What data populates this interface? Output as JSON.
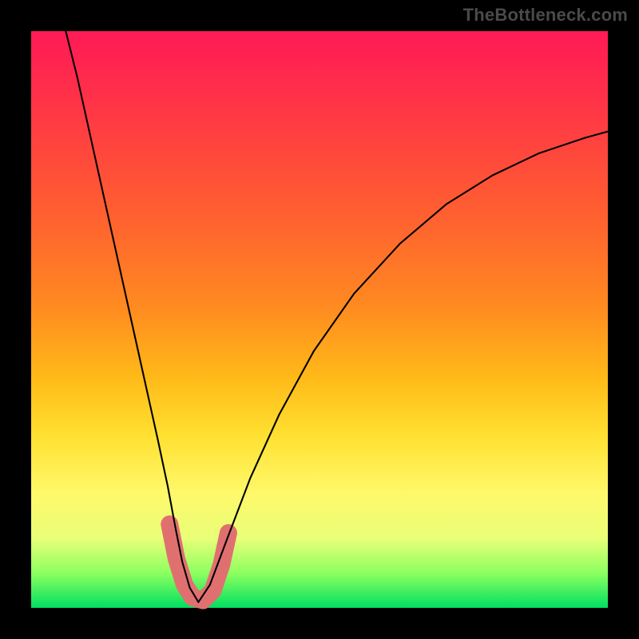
{
  "watermark": "TheBottleneck.com",
  "chart_data": {
    "type": "line",
    "title": "",
    "xlabel": "",
    "ylabel": "",
    "x_range_normalized": [
      0,
      1
    ],
    "y_range_normalized": [
      0,
      1
    ],
    "note": "Axes are unlabeled; values are normalized plot-fraction coordinates (0 = left/bottom, 1 = right/top). Two curves descend sharply to a minimum near x≈0.29 and rise again; a salmon band highlights the trough.",
    "series": [
      {
        "name": "left-branch",
        "stroke": "#000000",
        "points_xy": [
          [
            0.06,
            1.0
          ],
          [
            0.08,
            0.92
          ],
          [
            0.1,
            0.83
          ],
          [
            0.12,
            0.74
          ],
          [
            0.14,
            0.65
          ],
          [
            0.16,
            0.56
          ],
          [
            0.18,
            0.47
          ],
          [
            0.2,
            0.38
          ],
          [
            0.22,
            0.29
          ],
          [
            0.237,
            0.21
          ],
          [
            0.25,
            0.14
          ],
          [
            0.262,
            0.08
          ],
          [
            0.275,
            0.035
          ],
          [
            0.29,
            0.01
          ]
        ]
      },
      {
        "name": "right-branch",
        "stroke": "#000000",
        "points_xy": [
          [
            0.29,
            0.01
          ],
          [
            0.31,
            0.04
          ],
          [
            0.34,
            0.12
          ],
          [
            0.38,
            0.225
          ],
          [
            0.43,
            0.335
          ],
          [
            0.49,
            0.445
          ],
          [
            0.56,
            0.545
          ],
          [
            0.64,
            0.632
          ],
          [
            0.72,
            0.7
          ],
          [
            0.8,
            0.75
          ],
          [
            0.88,
            0.788
          ],
          [
            0.96,
            0.815
          ],
          [
            1.0,
            0.826
          ]
        ]
      },
      {
        "name": "trough-highlight",
        "stroke": "#e07070",
        "style": "thick-rounded",
        "points_xy": [
          [
            0.24,
            0.145
          ],
          [
            0.252,
            0.085
          ],
          [
            0.266,
            0.04
          ],
          [
            0.28,
            0.018
          ],
          [
            0.298,
            0.013
          ],
          [
            0.315,
            0.03
          ],
          [
            0.33,
            0.075
          ],
          [
            0.342,
            0.13
          ]
        ]
      }
    ]
  }
}
